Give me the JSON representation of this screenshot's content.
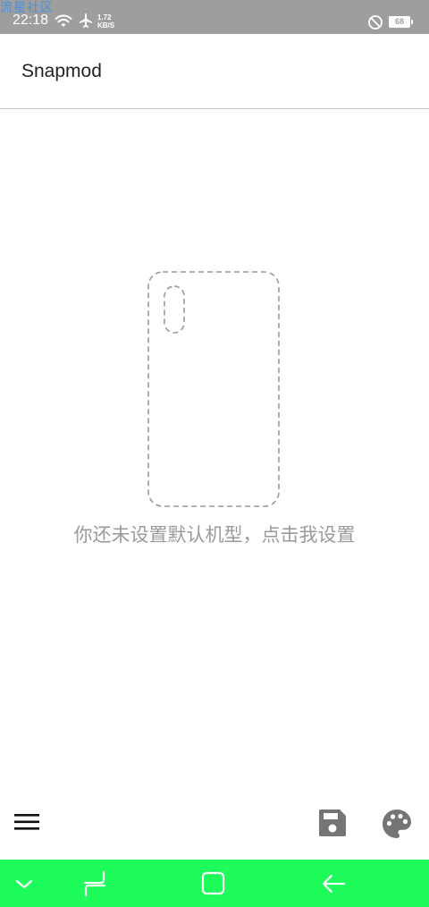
{
  "status_bar": {
    "watermark": "流星社区",
    "time": "22:18",
    "net_speed_value": "1.72",
    "net_speed_unit": "KB/S",
    "battery": "68",
    "icons": [
      "wifi-icon",
      "airplane-icon",
      "do-not-disturb-icon",
      "battery-icon"
    ]
  },
  "app_bar": {
    "title": "Snapmod"
  },
  "main": {
    "illustration": "phone-outline-icon",
    "empty_message": "你还未设置默认机型，点击我设置"
  },
  "bottom_toolbar": {
    "icons": [
      "menu-icon",
      "save-icon",
      "palette-icon"
    ]
  },
  "nav_bar": {
    "color": "#1dfc5a",
    "icons": [
      "chevron-down-icon",
      "recents-icon",
      "home-icon",
      "back-arrow-icon"
    ]
  },
  "colors": {
    "status_bar": "#9e9e9e",
    "icon_gray": "#757575",
    "message_gray": "#9a9a9a"
  }
}
